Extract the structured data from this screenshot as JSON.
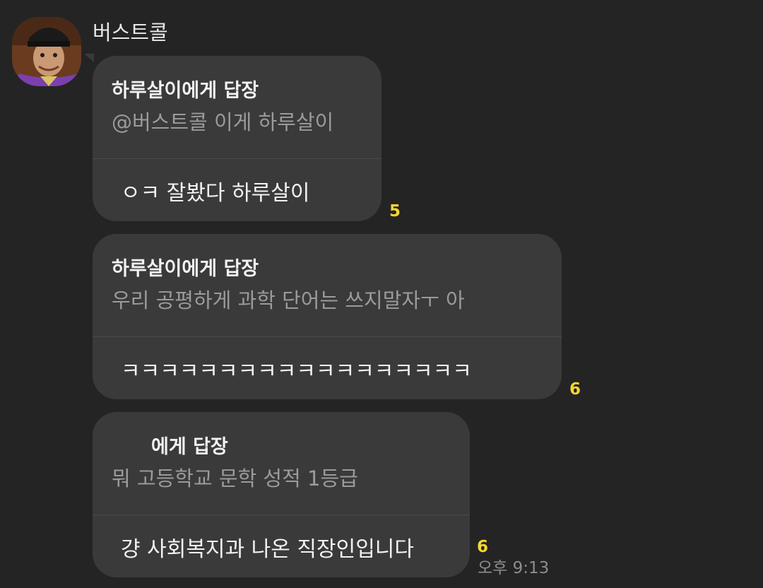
{
  "sender": {
    "name": "버스트콜"
  },
  "messages": [
    {
      "reply_title": "하루살이에게 답장",
      "reply_quote": "@버스트콜 이게 하루살이",
      "text": "ㅇㅋ 잘봤다 하루살이",
      "unread_count": "5"
    },
    {
      "reply_title": "하루살이에게 답장",
      "reply_quote": "우리 공평하게 과학 단어는 쓰지말자ㅜ        아",
      "text": "ㅋㅋㅋㅋㅋㅋㅋㅋㅋㅋㅋㅋㅋㅋㅋㅋㅋㅋ",
      "unread_count": "6"
    },
    {
      "reply_title": "에게 답장",
      "reply_quote": "뭐 고등학교 문학 성적 1등급",
      "text": "걍 사회복지과 나온 직장인입니다",
      "unread_count": "6",
      "time": "오후 9:13"
    }
  ],
  "colors": {
    "background": "#242424",
    "bubble": "#3a3a3a",
    "unread_count": "#f5d731",
    "reply_quote": "#9b9b9b"
  }
}
